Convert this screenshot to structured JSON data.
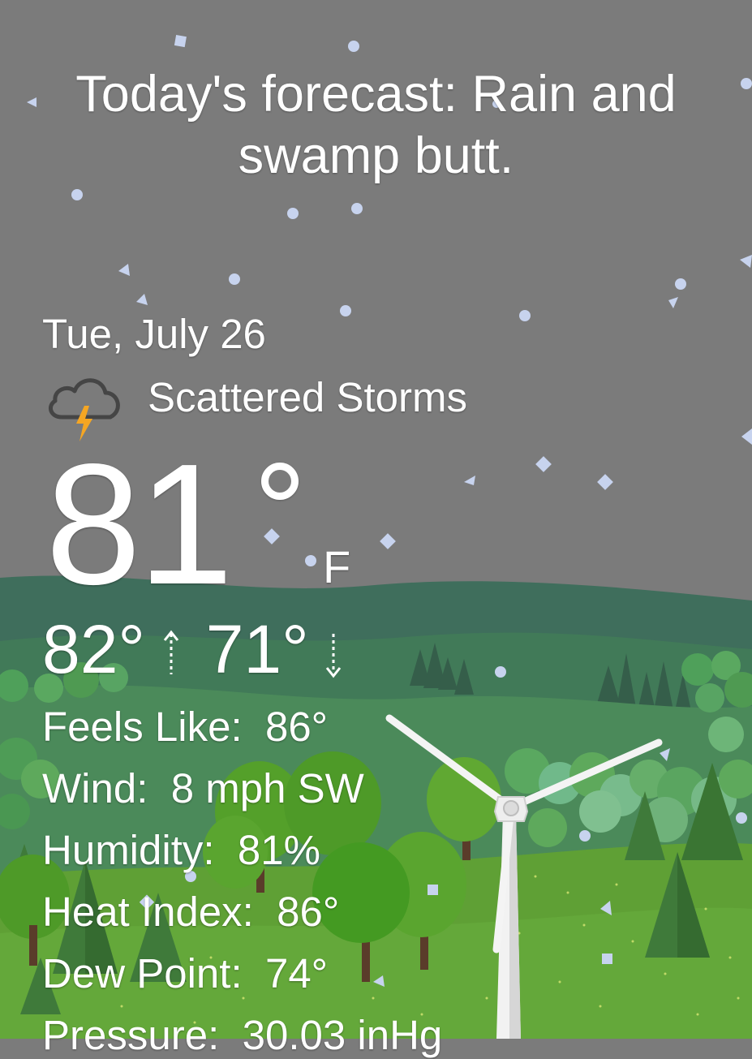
{
  "forecast": {
    "text": "Today's forecast: Rain and swamp butt."
  },
  "current": {
    "date": "Tue, July 26",
    "condition": "Scattered Storms",
    "condition_icon": "storm-cloud-icon",
    "temperature": "81",
    "unit": "F",
    "high": "82°",
    "low": "71°"
  },
  "metrics": [
    {
      "label": "Feels Like:",
      "value": "86°"
    },
    {
      "label": "Wind:",
      "value": "8 mph SW"
    },
    {
      "label": "Humidity:",
      "value": "81%"
    },
    {
      "label": "Heat Index:",
      "value": "86°"
    },
    {
      "label": "Dew Point:",
      "value": "74°"
    },
    {
      "label": "Pressure:",
      "value": "30.03 inHg"
    }
  ],
  "colors": {
    "sky": "#7b7b7b",
    "far_hills": "#3f6e5c",
    "mid_hills": "#4b8a5a",
    "meadow": "#5fa035",
    "lightning": "#f5a623",
    "snow": "#c7d3ee"
  }
}
